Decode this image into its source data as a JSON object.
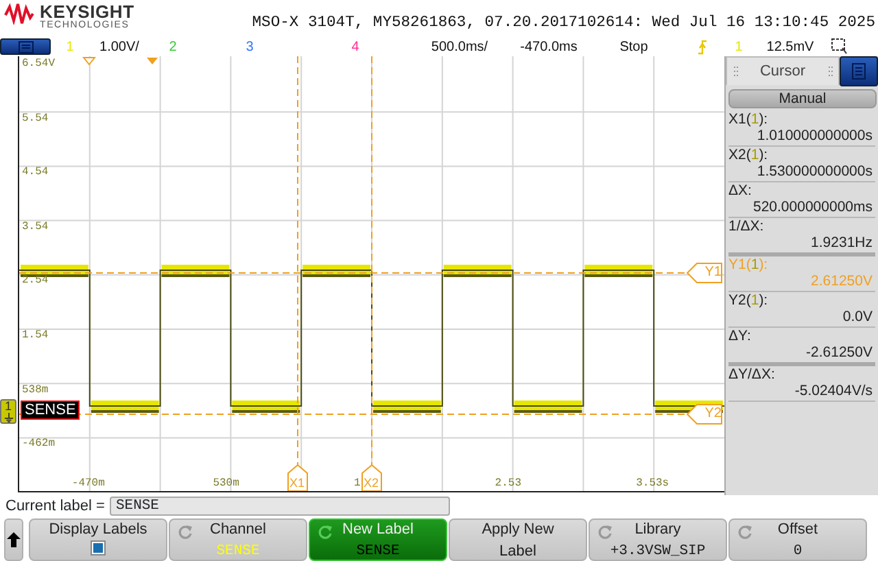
{
  "header": {
    "logo_name": "KEYSIGHT",
    "logo_sub": "TECHNOLOGIES",
    "title": "MSO-X 3104T, MY58261863, 07.20.2017102614: Wed Jul 16 13:10:45 2025"
  },
  "status_bar": [
    {
      "kind": "channel",
      "text": "1",
      "color": "#e8e800"
    },
    {
      "kind": "text",
      "text": "1.00V/"
    },
    {
      "kind": "channel",
      "text": "2",
      "color": "#33cc33"
    },
    {
      "kind": "channel",
      "text": "3",
      "color": "#3377ff"
    },
    {
      "kind": "channel",
      "text": "4",
      "color": "#ff3399"
    },
    {
      "kind": "text",
      "text": "500.0ms/"
    },
    {
      "kind": "text",
      "text": "-470.0ms"
    },
    {
      "kind": "text",
      "text": "Stop"
    },
    {
      "kind": "trigger"
    },
    {
      "kind": "channel",
      "text": "1",
      "color": "#e8e800"
    },
    {
      "kind": "text",
      "text": "12.5mV"
    },
    {
      "kind": "zoom"
    }
  ],
  "graph": {
    "y_labels": [
      "6.54V",
      "5.54",
      "4.54",
      "3.54",
      "2.54",
      "1.54",
      "538m",
      "-462m"
    ],
    "x_labels": [
      "-470m",
      "530m",
      "1",
      "2.53",
      "3.53s"
    ],
    "x_cursors": [
      "X1",
      "X2"
    ],
    "y_cursors": [
      "Y1",
      "Y2"
    ],
    "ground_marker": "1",
    "trace_label": "SENSE"
  },
  "cursor_panel": {
    "title": "Cursor",
    "mode": "Manual",
    "entries": [
      {
        "label": [
          "X1(",
          "1",
          "):"
        ],
        "value": "1.010000000000s",
        "active": false,
        "divider": false
      },
      {
        "label": [
          "X2(",
          "1",
          "):"
        ],
        "value": "1.530000000000s",
        "active": false,
        "divider": false
      },
      {
        "label": [
          "ΔX:"
        ],
        "value": "520.000000000ms",
        "active": false,
        "divider": false
      },
      {
        "label": [
          "1/ΔX:"
        ],
        "value": "1.9231Hz",
        "active": false,
        "divider": true
      },
      {
        "label": [
          "Y1(",
          "1",
          "):"
        ],
        "value": "2.61250V",
        "active": true,
        "divider": false
      },
      {
        "label": [
          "Y2(",
          "1",
          "):"
        ],
        "value": "0.0V",
        "active": false,
        "divider": false
      },
      {
        "label": [
          "ΔY:"
        ],
        "value": "-2.61250V",
        "active": false,
        "divider": true
      },
      {
        "label": [
          "ΔY/ΔX:"
        ],
        "value": "-5.02404V/s",
        "active": false,
        "divider": false
      }
    ]
  },
  "current_label": {
    "label": "Current label =",
    "value": "SENSE"
  },
  "softkeys": [
    {
      "kind": "arrow"
    },
    {
      "kind": "checkbox",
      "title": "Display Labels",
      "checked": true,
      "selected": false
    },
    {
      "kind": "rotary",
      "title": "Channel",
      "value": "SENSE",
      "color": "#ffff00",
      "selected": false
    },
    {
      "kind": "rotary",
      "title": "New Label",
      "value": "SENSE",
      "color": "#000000",
      "selected": true
    },
    {
      "kind": "plain",
      "title": "Apply New",
      "value": "Label",
      "color": "#1a1a1a",
      "selected": false
    },
    {
      "kind": "rotary",
      "title": "Library",
      "value": "+3.3VSW_SIP",
      "color": "#1a1a1a",
      "selected": false
    },
    {
      "kind": "rotary",
      "title": "Offset",
      "value": "0",
      "color": "#1a1a1a",
      "selected": false
    }
  ]
}
